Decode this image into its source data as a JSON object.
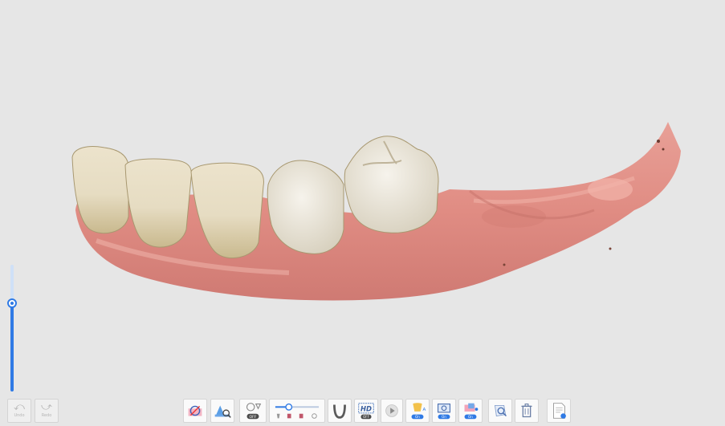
{
  "history": {
    "undo_label": "Undo",
    "redo_label": "Redo"
  },
  "viewer": {
    "scan_subject": "lower-jaw-3d-scan",
    "depth_slider_value": 0.71
  },
  "toolbar": {
    "hd_label": "HD",
    "off_label": "OFF",
    "on_label": "On",
    "on_label_2": "On",
    "on_label_3": "On"
  },
  "colors": {
    "accent": "#2f7ae5",
    "background": "#e6e6e6",
    "gum": "#e08f86",
    "tooth": "#e9e1cc"
  }
}
